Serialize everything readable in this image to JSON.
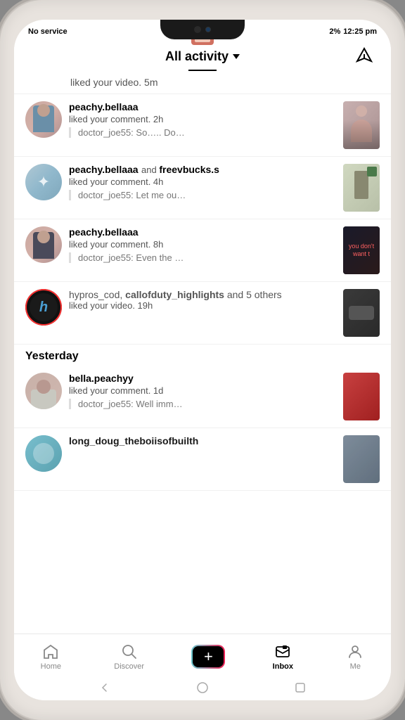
{
  "status": {
    "carrier": "No service",
    "signal_icon": "signal",
    "battery_percent": "2%",
    "time": "12:25 pm"
  },
  "header": {
    "title": "All activity",
    "dropdown_label": "All activity ▾",
    "send_icon": "send"
  },
  "activity": {
    "first_item_text": "liked your video. 5m",
    "items": [
      {
        "username": "peachy.bellaaa",
        "action": "liked your comment. 2h",
        "comment": "doctor_joe55: So….. Do…",
        "has_thumb": true,
        "avatar_type": "peachy1"
      },
      {
        "username": "peachy.bellaaa",
        "co_username": "freevbucks.s",
        "action": "liked your comment. 4h",
        "comment": "doctor_joe55: Let me ou…",
        "has_thumb": true,
        "avatar_type": "peachy2"
      },
      {
        "username": "peachy.bellaaa",
        "action": "liked your comment. 8h",
        "comment": "doctor_joe55: Even the …",
        "has_thumb": true,
        "avatar_type": "peachy3"
      },
      {
        "username": "hypros_cod,",
        "bold_part": "callofduty_highlights",
        "suffix": " and 5 others",
        "action": "liked your video. 19h",
        "has_thumb": true,
        "avatar_type": "hypros"
      }
    ],
    "yesterday_label": "Yesterday",
    "yesterday_items": [
      {
        "username": "bella.peachyy",
        "action": "liked your comment. 1d",
        "comment": "doctor_joe55: Well imm…",
        "has_thumb": true,
        "avatar_type": "bella"
      },
      {
        "username": "long_doug_theboiisofbuilth",
        "action": "",
        "has_thumb": true,
        "avatar_type": "long"
      }
    ]
  },
  "nav": {
    "items": [
      {
        "label": "Home",
        "icon": "home",
        "active": false
      },
      {
        "label": "Discover",
        "icon": "search",
        "active": false
      },
      {
        "label": "",
        "icon": "add",
        "active": false
      },
      {
        "label": "Inbox",
        "icon": "inbox",
        "active": true
      },
      {
        "label": "Me",
        "icon": "person",
        "active": false
      }
    ]
  },
  "system_bar": {
    "back": "‹",
    "home_circle": "○",
    "recent": "□"
  }
}
